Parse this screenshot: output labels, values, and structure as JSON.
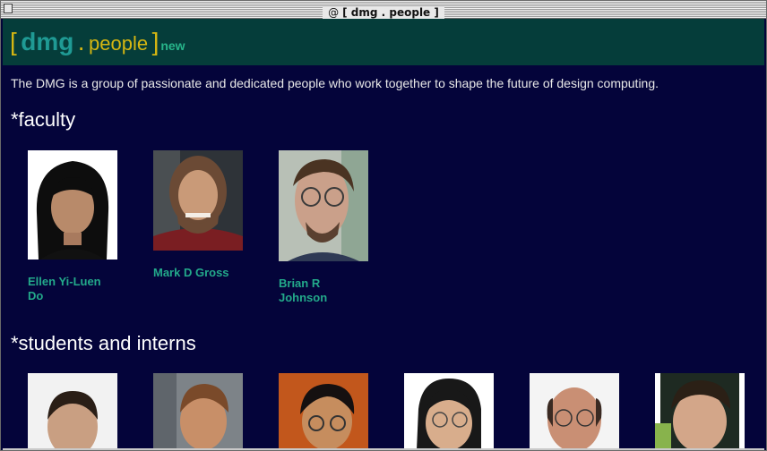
{
  "window": {
    "title": "[ dmg . people ]"
  },
  "header": {
    "bracket_open": "[",
    "dmg": "dmg",
    "dot": ".",
    "people": "people",
    "bracket_close": "]",
    "new_label": "new",
    "colors": {
      "background": "#053d3a",
      "gold": "#d5b612",
      "teal": "#1f9a94",
      "green": "#27b58a"
    }
  },
  "intro": "The DMG is a group of passionate and dedicated people who work together to shape the future of design computing.",
  "sections": {
    "faculty": {
      "title": "*faculty",
      "people": [
        {
          "name": "Ellen Yi-Luen Do"
        },
        {
          "name": "Mark D Gross"
        },
        {
          "name": "Brian R Johnson"
        }
      ]
    },
    "students": {
      "title": "*students and interns"
    }
  },
  "colors": {
    "page_background": "#04043a",
    "link_text": "#23a98a"
  }
}
